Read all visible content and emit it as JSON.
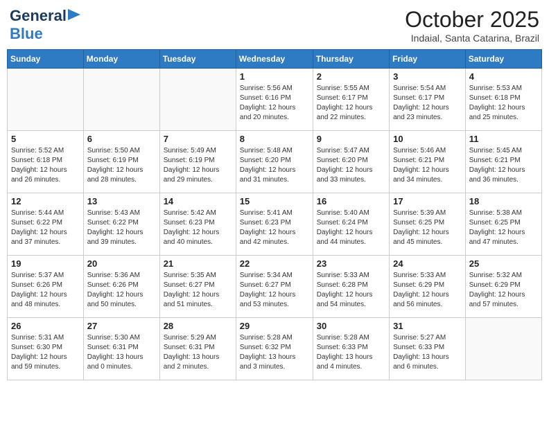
{
  "header": {
    "logo_gen": "General",
    "logo_blue": "Blue",
    "month": "October 2025",
    "location": "Indaial, Santa Catarina, Brazil"
  },
  "weekdays": [
    "Sunday",
    "Monday",
    "Tuesday",
    "Wednesday",
    "Thursday",
    "Friday",
    "Saturday"
  ],
  "weeks": [
    [
      {
        "day": "",
        "info": ""
      },
      {
        "day": "",
        "info": ""
      },
      {
        "day": "",
        "info": ""
      },
      {
        "day": "1",
        "info": "Sunrise: 5:56 AM\nSunset: 6:16 PM\nDaylight: 12 hours\nand 20 minutes."
      },
      {
        "day": "2",
        "info": "Sunrise: 5:55 AM\nSunset: 6:17 PM\nDaylight: 12 hours\nand 22 minutes."
      },
      {
        "day": "3",
        "info": "Sunrise: 5:54 AM\nSunset: 6:17 PM\nDaylight: 12 hours\nand 23 minutes."
      },
      {
        "day": "4",
        "info": "Sunrise: 5:53 AM\nSunset: 6:18 PM\nDaylight: 12 hours\nand 25 minutes."
      }
    ],
    [
      {
        "day": "5",
        "info": "Sunrise: 5:52 AM\nSunset: 6:18 PM\nDaylight: 12 hours\nand 26 minutes."
      },
      {
        "day": "6",
        "info": "Sunrise: 5:50 AM\nSunset: 6:19 PM\nDaylight: 12 hours\nand 28 minutes."
      },
      {
        "day": "7",
        "info": "Sunrise: 5:49 AM\nSunset: 6:19 PM\nDaylight: 12 hours\nand 29 minutes."
      },
      {
        "day": "8",
        "info": "Sunrise: 5:48 AM\nSunset: 6:20 PM\nDaylight: 12 hours\nand 31 minutes."
      },
      {
        "day": "9",
        "info": "Sunrise: 5:47 AM\nSunset: 6:20 PM\nDaylight: 12 hours\nand 33 minutes."
      },
      {
        "day": "10",
        "info": "Sunrise: 5:46 AM\nSunset: 6:21 PM\nDaylight: 12 hours\nand 34 minutes."
      },
      {
        "day": "11",
        "info": "Sunrise: 5:45 AM\nSunset: 6:21 PM\nDaylight: 12 hours\nand 36 minutes."
      }
    ],
    [
      {
        "day": "12",
        "info": "Sunrise: 5:44 AM\nSunset: 6:22 PM\nDaylight: 12 hours\nand 37 minutes."
      },
      {
        "day": "13",
        "info": "Sunrise: 5:43 AM\nSunset: 6:22 PM\nDaylight: 12 hours\nand 39 minutes."
      },
      {
        "day": "14",
        "info": "Sunrise: 5:42 AM\nSunset: 6:23 PM\nDaylight: 12 hours\nand 40 minutes."
      },
      {
        "day": "15",
        "info": "Sunrise: 5:41 AM\nSunset: 6:23 PM\nDaylight: 12 hours\nand 42 minutes."
      },
      {
        "day": "16",
        "info": "Sunrise: 5:40 AM\nSunset: 6:24 PM\nDaylight: 12 hours\nand 44 minutes."
      },
      {
        "day": "17",
        "info": "Sunrise: 5:39 AM\nSunset: 6:25 PM\nDaylight: 12 hours\nand 45 minutes."
      },
      {
        "day": "18",
        "info": "Sunrise: 5:38 AM\nSunset: 6:25 PM\nDaylight: 12 hours\nand 47 minutes."
      }
    ],
    [
      {
        "day": "19",
        "info": "Sunrise: 5:37 AM\nSunset: 6:26 PM\nDaylight: 12 hours\nand 48 minutes."
      },
      {
        "day": "20",
        "info": "Sunrise: 5:36 AM\nSunset: 6:26 PM\nDaylight: 12 hours\nand 50 minutes."
      },
      {
        "day": "21",
        "info": "Sunrise: 5:35 AM\nSunset: 6:27 PM\nDaylight: 12 hours\nand 51 minutes."
      },
      {
        "day": "22",
        "info": "Sunrise: 5:34 AM\nSunset: 6:27 PM\nDaylight: 12 hours\nand 53 minutes."
      },
      {
        "day": "23",
        "info": "Sunrise: 5:33 AM\nSunset: 6:28 PM\nDaylight: 12 hours\nand 54 minutes."
      },
      {
        "day": "24",
        "info": "Sunrise: 5:33 AM\nSunset: 6:29 PM\nDaylight: 12 hours\nand 56 minutes."
      },
      {
        "day": "25",
        "info": "Sunrise: 5:32 AM\nSunset: 6:29 PM\nDaylight: 12 hours\nand 57 minutes."
      }
    ],
    [
      {
        "day": "26",
        "info": "Sunrise: 5:31 AM\nSunset: 6:30 PM\nDaylight: 12 hours\nand 59 minutes."
      },
      {
        "day": "27",
        "info": "Sunrise: 5:30 AM\nSunset: 6:31 PM\nDaylight: 13 hours\nand 0 minutes."
      },
      {
        "day": "28",
        "info": "Sunrise: 5:29 AM\nSunset: 6:31 PM\nDaylight: 13 hours\nand 2 minutes."
      },
      {
        "day": "29",
        "info": "Sunrise: 5:28 AM\nSunset: 6:32 PM\nDaylight: 13 hours\nand 3 minutes."
      },
      {
        "day": "30",
        "info": "Sunrise: 5:28 AM\nSunset: 6:33 PM\nDaylight: 13 hours\nand 4 minutes."
      },
      {
        "day": "31",
        "info": "Sunrise: 5:27 AM\nSunset: 6:33 PM\nDaylight: 13 hours\nand 6 minutes."
      },
      {
        "day": "",
        "info": ""
      }
    ]
  ]
}
